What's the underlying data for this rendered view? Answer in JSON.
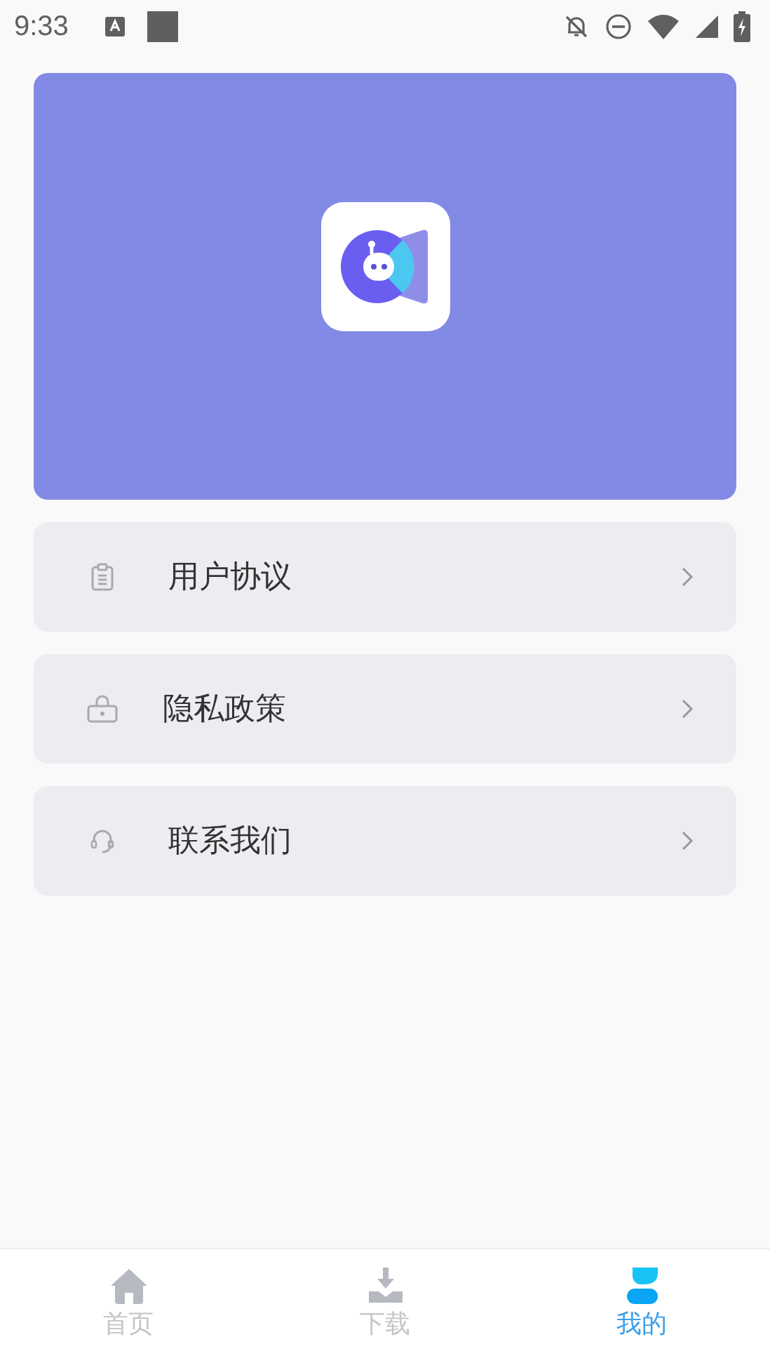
{
  "status_bar": {
    "time": "9:33"
  },
  "menu": [
    {
      "label": "用户协议"
    },
    {
      "label": "隐私政策"
    },
    {
      "label": "联系我们"
    }
  ],
  "tabs": [
    {
      "label": "首页",
      "selected": false
    },
    {
      "label": "下载",
      "selected": false
    },
    {
      "label": "我的",
      "selected": true
    }
  ]
}
